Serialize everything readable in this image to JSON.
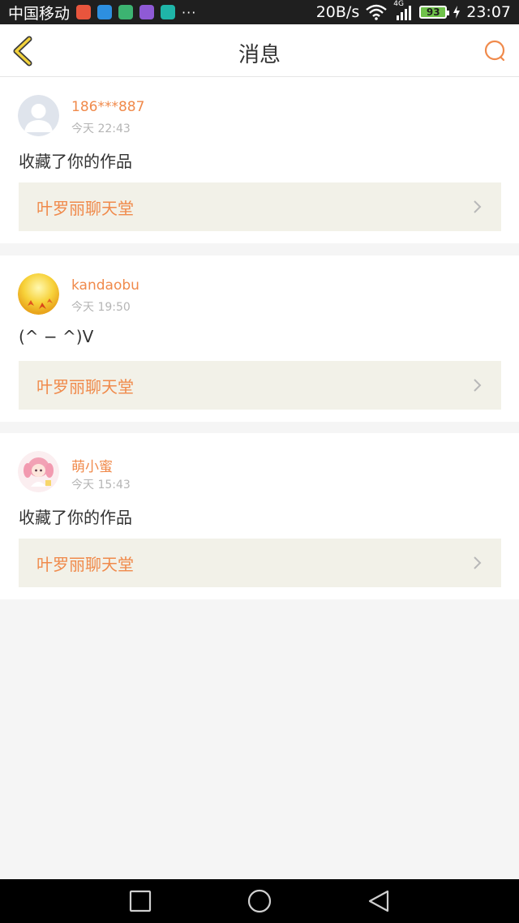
{
  "status_bar": {
    "carrier": "中国移动",
    "more": "···",
    "speed": "20B/s",
    "network": "4G",
    "battery": "93",
    "time": "23:07"
  },
  "header": {
    "title": "消息"
  },
  "messages": [
    {
      "username": "186***887",
      "time": "今天 22:43",
      "content": "收藏了你的作品",
      "work_title": "叶罗丽聊天堂"
    },
    {
      "username": "kandaobu",
      "time": "今天 19:50",
      "content": "(^ − ^)V",
      "work_title": "叶罗丽聊天堂"
    },
    {
      "username": "萌小蜜",
      "time": "今天 15:43",
      "content": "收藏了你的作品",
      "work_title": "叶罗丽聊天堂"
    }
  ],
  "colors": {
    "accent": "#f08a4b",
    "link_bg": "#f2f1e8",
    "background": "#f5f5f5"
  }
}
